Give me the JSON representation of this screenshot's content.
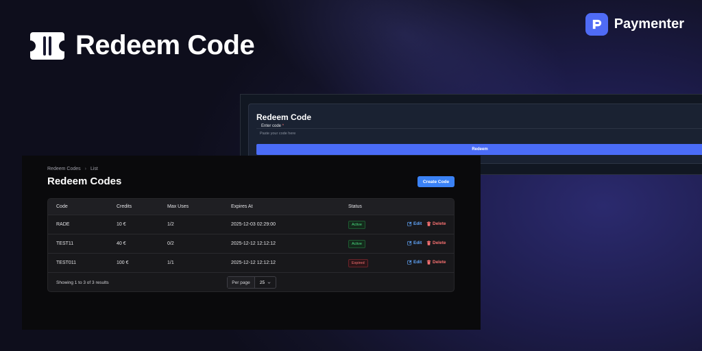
{
  "hero": {
    "title": "Redeem Code",
    "brand": "Paymenter"
  },
  "redeem_form": {
    "title": "Redeem Code",
    "field_label": "Enter code",
    "required_mark": "*",
    "placeholder": "Paste your code here",
    "submit_label": "Redeem"
  },
  "admin": {
    "breadcrumb": [
      "Redeem Codes",
      "List"
    ],
    "title": "Redeem Codes",
    "create_label": "Create Code",
    "columns": [
      "Code",
      "Credits",
      "Max Uses",
      "Expires At",
      "Status"
    ],
    "rows": [
      {
        "code": "RADE",
        "credits": "10 €",
        "max_uses": "1/2",
        "expires_at": "2025-12-03 02:29:00",
        "status": "Active"
      },
      {
        "code": "TEST11",
        "credits": "40 €",
        "max_uses": "0/2",
        "expires_at": "2025-12-12 12:12:12",
        "status": "Active"
      },
      {
        "code": "TEST011",
        "credits": "100 €",
        "max_uses": "1/1",
        "expires_at": "2025-12-12 12:12:12",
        "status": "Expired"
      }
    ],
    "edit_label": "Edit",
    "delete_label": "Delete",
    "footer": {
      "showing": "Showing 1 to 3 of 3 results",
      "per_page_label": "Per page",
      "per_page_value": "25"
    }
  },
  "colors": {
    "accent": "#4a6cf7",
    "create_button": "#3b82f6",
    "active": "#4ade80",
    "expired": "#f87171",
    "edit": "#60a5fa"
  }
}
